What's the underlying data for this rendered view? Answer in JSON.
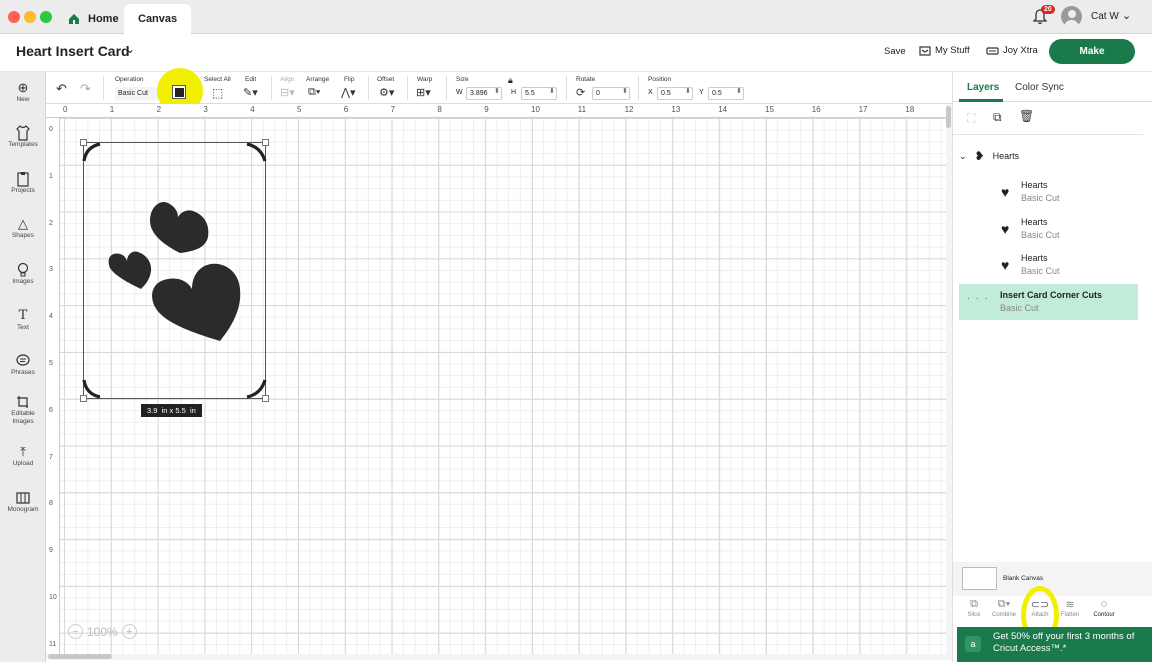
{
  "window": {
    "tabs": [
      {
        "label": "Home",
        "icon": "home-icon"
      },
      {
        "label": "Canvas"
      }
    ],
    "notification_count": "20",
    "user_name": "Cat W"
  },
  "project": {
    "title": "Heart Insert Card",
    "save_label": "Save",
    "my_stuff_label": "My Stuff",
    "machine_label": "Joy Xtra",
    "make_label": "Make"
  },
  "left_nav": {
    "items": [
      {
        "label": "New",
        "icon": "plus-circle-icon"
      },
      {
        "label": "Templates",
        "icon": "shirt-icon"
      },
      {
        "label": "Projects",
        "icon": "clipboard-icon"
      },
      {
        "label": "Shapes",
        "icon": "shapes-icon"
      },
      {
        "label": "Images",
        "icon": "lightbulb-icon"
      },
      {
        "label": "Text",
        "icon": "text-icon"
      },
      {
        "label": "Phrases",
        "icon": "speech-bubble-icon"
      },
      {
        "label": "Editable Images",
        "icon": "editable-image-icon"
      },
      {
        "label": "Upload",
        "icon": "upload-icon"
      },
      {
        "label": "Monogram",
        "icon": "monogram-icon"
      }
    ]
  },
  "toolbar": {
    "operation_label": "Operation",
    "operation_value": "Basic Cut",
    "select_all_label": "Select All",
    "edit_label": "Edit",
    "align_label": "Align",
    "arrange_label": "Arrange",
    "flip_label": "Flip",
    "offset_label": "Offset",
    "warp_label": "Warp",
    "size_label": "Size",
    "w_label": "W",
    "w_value": "3.896",
    "h_label": "H",
    "h_value": "5.5",
    "rotate_label": "Rotate",
    "rotate_value": "0",
    "position_label": "Position",
    "x_label": "X",
    "x_value": "0.5",
    "y_label": "Y",
    "y_value": "0.5",
    "color_swatch": "#222222",
    "highlight_color": "#f2ee00"
  },
  "rulers": {
    "top": [
      "0",
      "1",
      "2",
      "3",
      "4",
      "5",
      "6",
      "7",
      "8",
      "9",
      "10",
      "11",
      "12",
      "13",
      "14",
      "15",
      "16",
      "17",
      "18"
    ],
    "left": [
      "0",
      "1",
      "2",
      "3",
      "4",
      "5",
      "6",
      "7",
      "8",
      "9",
      "10",
      "11"
    ]
  },
  "canvas": {
    "size_tooltip": "3.9  in x 5.5  in",
    "zoom_label": "100%"
  },
  "right_panel": {
    "tabs": [
      "Layers",
      "Color Sync"
    ],
    "group_name": "Hearts",
    "layers": [
      {
        "name": "Hearts",
        "operation": "Basic Cut"
      },
      {
        "name": "Hearts",
        "operation": "Basic Cut"
      },
      {
        "name": "Hearts",
        "operation": "Basic Cut"
      },
      {
        "name": "Insert Card Corner Cuts",
        "operation": "Basic Cut"
      }
    ],
    "blank_canvas_label": "Blank Canvas",
    "bottom_tools": [
      {
        "label": "Slice",
        "icon": "slice-icon"
      },
      {
        "label": "Combine",
        "icon": "combine-icon"
      },
      {
        "label": "Attach",
        "icon": "attach-icon"
      },
      {
        "label": "Flatten",
        "icon": "flatten-icon"
      },
      {
        "label": "Contour",
        "icon": "contour-icon"
      }
    ],
    "promo_text": "Get 50% off your first 3 months of Cricut Access™.*",
    "accent_color": "#1a7a4c",
    "selected_layer_color": "#c2ecda"
  }
}
